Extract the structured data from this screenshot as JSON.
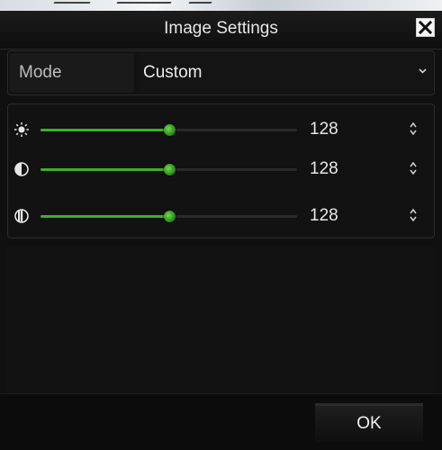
{
  "dialog": {
    "title": "Image Settings",
    "close_icon": "close-icon"
  },
  "mode": {
    "label": "Mode",
    "value": "Custom",
    "dropdown_icon": "chevron-down-icon"
  },
  "sliders": [
    {
      "icon": "brightness-icon",
      "value": "128",
      "level": 0.5
    },
    {
      "icon": "contrast-icon",
      "value": "128",
      "level": 0.5
    },
    {
      "icon": "saturation-icon",
      "value": "128",
      "level": 0.5
    }
  ],
  "footer": {
    "ok_label": "OK"
  },
  "colors": {
    "accent": "#3fae2a",
    "background": "#101010"
  }
}
